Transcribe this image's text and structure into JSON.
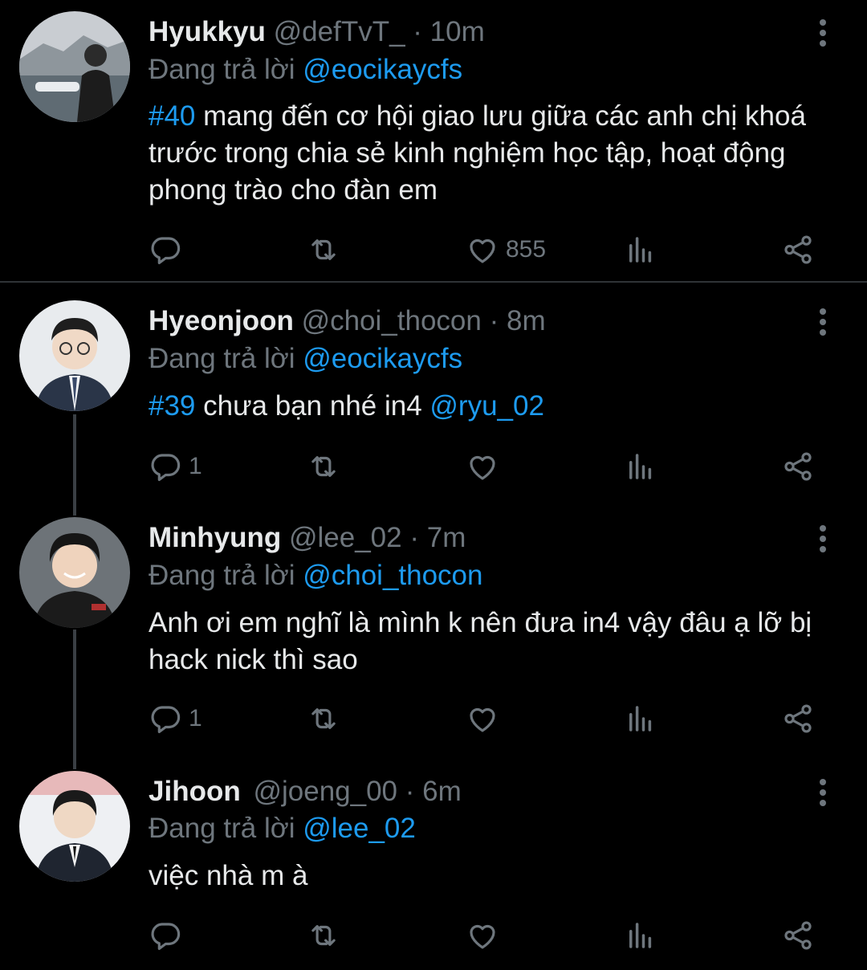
{
  "tweets": [
    {
      "name": "Hyukkyu",
      "handle": "@defTvT_",
      "time": "· 10m",
      "reply_prefix": "Đang trả lời ",
      "reply_to": "@eocikaycfs",
      "tag": "#40",
      "text": " mang đến cơ hội giao lưu giữa các anh chị khoá trước trong chia sẻ kinh nghiệm học tập, hoạt động phong trào cho đàn em",
      "reply_count": "",
      "like_count": "855"
    },
    {
      "name": "Hyeonjoon",
      "handle": "@choi_thocon",
      "time": "· 8m",
      "reply_prefix": "Đang trả lời ",
      "reply_to": "@eocikaycfs",
      "tag": "#39",
      "text": " chưa bạn nhé in4 ",
      "mention": "@ryu_02",
      "reply_count": "1",
      "like_count": ""
    },
    {
      "name": "Minhyung",
      "handle": "@lee_02",
      "time": "· 7m",
      "reply_prefix": "Đang trả lời ",
      "reply_to": "@choi_thocon",
      "text": "Anh ơi em nghĩ là mình k nên đưa in4 vậy đâu ạ lỡ bị hack nick thì sao",
      "reply_count": "1",
      "like_count": ""
    },
    {
      "name": "Jihoon",
      "handle": "@joeng_00",
      "time": "· 6m",
      "reply_prefix": "Đang trả lời ",
      "reply_to": "@lee_02",
      "text": "việc nhà m à",
      "reply_count": "",
      "like_count": ""
    }
  ],
  "icons": {
    "reply": "reply-icon",
    "retweet": "retweet-icon",
    "like": "heart-icon",
    "views": "analytics-icon",
    "share": "share-icon",
    "more": "more-vertical-icon"
  },
  "colors": {
    "accent": "#1d9bf0",
    "muted": "#6e767d",
    "text": "#e7e9ea",
    "background": "#000000"
  }
}
